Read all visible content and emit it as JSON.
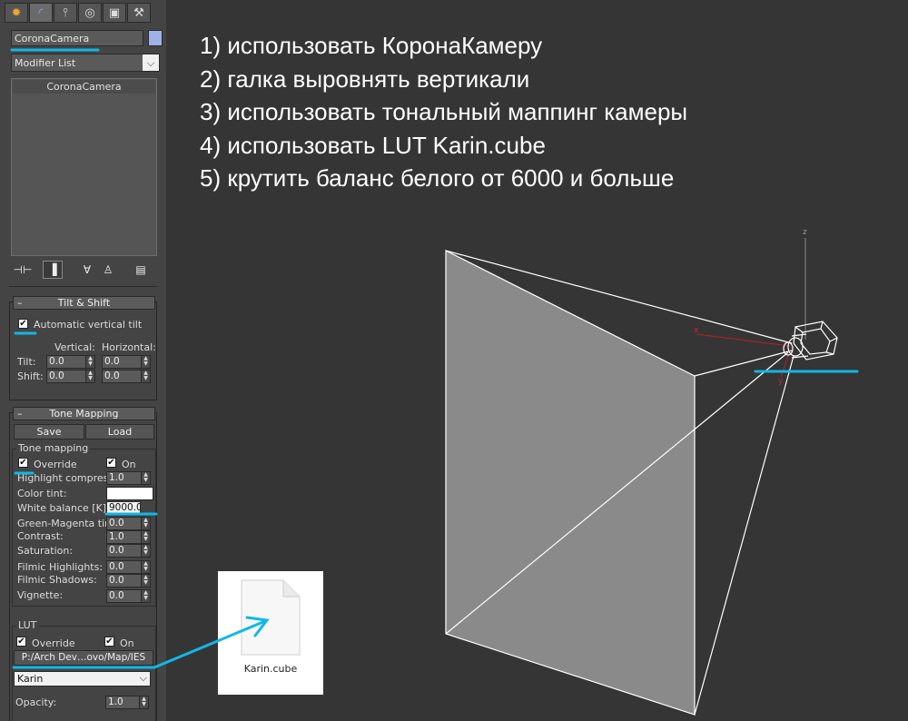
{
  "toolbar_tabs": [
    {
      "icon": "create-icon",
      "glyph": "✹"
    },
    {
      "icon": "modify-icon",
      "glyph": "◜"
    },
    {
      "icon": "hierarchy-icon",
      "glyph": "⫯"
    },
    {
      "icon": "motion-icon",
      "glyph": "◎"
    },
    {
      "icon": "display-icon",
      "glyph": "▣"
    },
    {
      "icon": "utilities-icon",
      "glyph": "⚒"
    }
  ],
  "object_name": "CoronaCamera",
  "object_color": "#9fb1e6",
  "modifier_list": {
    "selected": "Modifier List"
  },
  "stack": {
    "items": [
      "CoronaCamera"
    ]
  },
  "stack_tools": [
    "pin-stack-icon",
    "show-end-result-icon",
    "make-unique-icon",
    "remove-modifier-icon",
    "configure-modifier-sets-icon"
  ],
  "tilt_shift": {
    "title": "Tilt & Shift",
    "collapse": "–",
    "auto_vertical_tilt_label": "Automatic vertical tilt",
    "auto_vertical_tilt_checked": true,
    "vertical_label": "Vertical:",
    "horizontal_label": "Horizontal:",
    "tilt_label": "Tilt:",
    "shift_label": "Shift:",
    "tilt_vertical": "0.0",
    "tilt_horizontal": "0.0",
    "shift_vertical": "0.0",
    "shift_horizontal": "0.0"
  },
  "tone_mapping": {
    "title": "Tone Mapping",
    "collapse": "–",
    "save_label": "Save",
    "load_label": "Load",
    "group_label": "Tone mapping",
    "override_label": "Override",
    "override_checked": true,
    "on_label": "On",
    "on_checked": true,
    "highlight_compress_label": "Highlight compress:",
    "highlight_compress": "1.0",
    "color_tint_label": "Color tint:",
    "color_tint": "#ffffff",
    "white_balance_label": "White balance [K]:",
    "white_balance": "9000.0",
    "green_magenta_label": "Green-Magenta tint:",
    "green_magenta": "0.0",
    "contrast_label": "Contrast:",
    "contrast": "1.0",
    "saturation_label": "Saturation:",
    "saturation": "0.0",
    "filmic_highlights_label": "Filmic Highlights:",
    "filmic_highlights": "0.0",
    "filmic_shadows_label": "Filmic Shadows:",
    "filmic_shadows": "0.0",
    "vignette_label": "Vignette:",
    "vignette": "0.0"
  },
  "lut": {
    "group_label": "LUT",
    "override_label": "Override",
    "override_checked": true,
    "on_label": "On",
    "on_checked": true,
    "path": "P:/Arch Dev…ovo/Map/IES",
    "selected": "Karin",
    "opacity_label": "Opacity:",
    "opacity": "1.0"
  },
  "notes": [
    "1) использовать КоронаКамеру",
    "2) галка выровнять вертикали",
    "3) использовать тональный маппинг камеры",
    "4) использовать LUT Karin.cube",
    "5) крутить баланс белого от 6000 и больше"
  ],
  "file": {
    "name": "Karin.cube",
    "icon": "document-file-icon"
  },
  "viewport": {
    "axis_labels": {
      "z": "z",
      "x": "x",
      "y": "y"
    },
    "frustum_fill": "#8a8a8a",
    "camera_icon": "camera-icon"
  },
  "highlight_color": "#10b8e6"
}
